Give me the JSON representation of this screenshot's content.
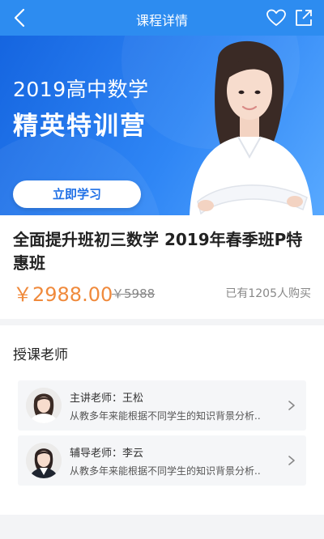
{
  "nav": {
    "title": "课程详情"
  },
  "banner": {
    "line1": "2019高中数学",
    "line2": "精英特训营",
    "button": "立即学习"
  },
  "course": {
    "title": "全面提升班初三数学 2019年春季班P特惠班",
    "price": "￥2988.00",
    "original_price": "￥5988",
    "buyers": "已有1205人购买"
  },
  "teachers": {
    "section_title": "授课老师",
    "items": [
      {
        "name": "主讲老师：王松",
        "desc": "从教多年来能根据不同学生的知识背景分析.."
      },
      {
        "name": "辅导老师：李云",
        "desc": "从教多年来能根据不同学生的知识背景分析.."
      }
    ]
  },
  "colors": {
    "nav_bg": "#2d8cf0",
    "price": "#f08a3c",
    "banner_button_text": "#1e6fe6"
  },
  "icons": [
    "back-icon",
    "heart-icon",
    "share-icon",
    "chevron-right-icon"
  ]
}
